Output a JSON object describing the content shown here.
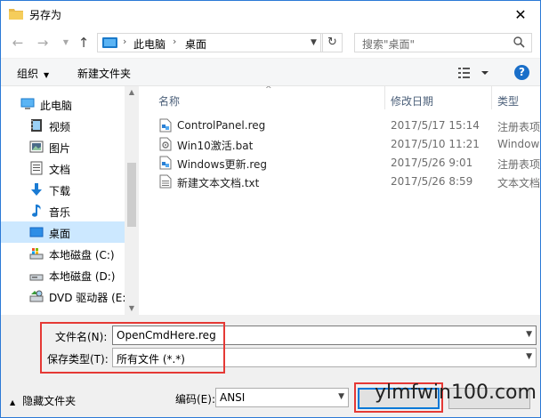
{
  "window": {
    "title": "另存为"
  },
  "address": {
    "crumbs": [
      "此电脑",
      "桌面"
    ],
    "search_placeholder": "搜索\"桌面\""
  },
  "toolbar": {
    "organize_label": "组织",
    "new_folder_label": "新建文件夹"
  },
  "nav": {
    "items": [
      {
        "label": "此电脑",
        "icon": "pc-icon"
      },
      {
        "label": "视频",
        "icon": "video-icon"
      },
      {
        "label": "图片",
        "icon": "picture-icon"
      },
      {
        "label": "文档",
        "icon": "document-icon"
      },
      {
        "label": "下载",
        "icon": "download-icon"
      },
      {
        "label": "音乐",
        "icon": "music-icon"
      },
      {
        "label": "桌面",
        "icon": "desktop-icon",
        "selected": true
      },
      {
        "label": "本地磁盘 (C:)",
        "icon": "drive-c-icon"
      },
      {
        "label": "本地磁盘 (D:)",
        "icon": "drive-d-icon"
      },
      {
        "label": "DVD 驱动器 (E:)",
        "icon": "dvd-icon"
      }
    ]
  },
  "files": {
    "columns": [
      "名称",
      "修改日期",
      "类型"
    ],
    "rows": [
      {
        "name": "ControlPanel.reg",
        "date": "2017/5/17 15:14",
        "type": "注册表项",
        "icon": "reg-file-icon"
      },
      {
        "name": "Win10激活.bat",
        "date": "2017/5/10 11:21",
        "type": "Windows",
        "icon": "bat-file-icon"
      },
      {
        "name": "Windows更新.reg",
        "date": "2017/5/26 9:01",
        "type": "注册表项",
        "icon": "reg-file-icon"
      },
      {
        "name": "新建文本文档.txt",
        "date": "2017/5/26 8:59",
        "type": "文本文档",
        "icon": "txt-file-icon"
      }
    ]
  },
  "form": {
    "filename_label": "文件名(N):",
    "filename_value": "OpenCmdHere.reg",
    "filetype_label": "保存类型(T):",
    "filetype_value": "所有文件  (*.*)",
    "encoding_label": "编码(E):",
    "encoding_value": "ANSI",
    "hide_folders_label": "隐藏文件夹"
  },
  "watermark": "ylmfwin100.com",
  "colors": {
    "accent": "#0078d7",
    "highlight": "#e53935",
    "selected_bg": "#cce8ff"
  }
}
